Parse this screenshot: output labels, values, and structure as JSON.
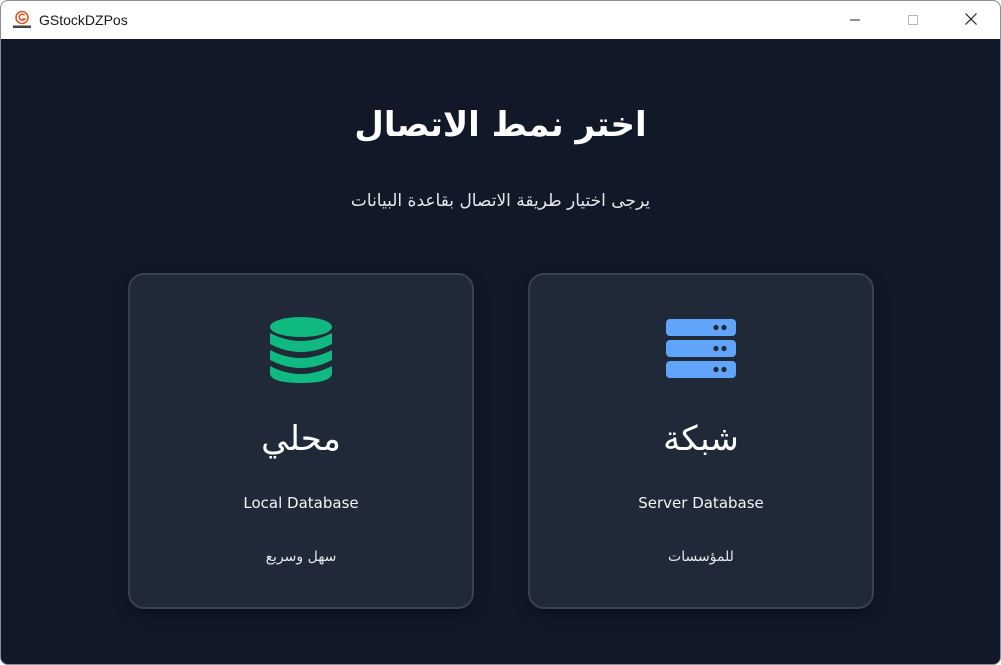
{
  "window": {
    "title": "GStockDZPos",
    "icon": "app-logo-icon",
    "controls": {
      "minimize": "minimize-icon",
      "maximize": "maximize-icon",
      "close": "close-icon"
    }
  },
  "main": {
    "title": "اختر نمط الاتصال",
    "subtitle": "يرجى اختيار طريقة الاتصال بقاعدة البيانات"
  },
  "options": {
    "local": {
      "icon": "database-icon",
      "icon_color": "#10b981",
      "title": "محلي",
      "subtitle": "Local Database",
      "note": "سهل وسريع"
    },
    "server": {
      "icon": "server-icon",
      "icon_color": "#60a5fa",
      "title": "شبكة",
      "subtitle": "Server Database",
      "note": "للمؤسسات"
    }
  },
  "colors": {
    "background": "#111827",
    "card": "#1f2937",
    "card_border": "#374151"
  }
}
